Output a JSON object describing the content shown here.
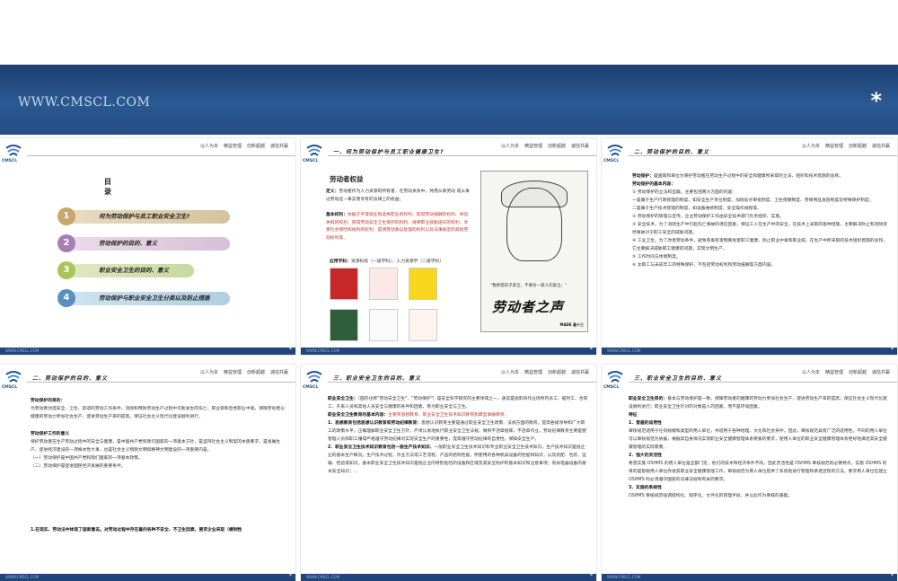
{
  "banner": {
    "url": "WWW.CMSCL.COM",
    "star": "*"
  },
  "header": {
    "logo_text": "CMSCL",
    "nav": [
      "以人为本",
      "精益管理",
      "创新超越",
      "诚信共赢"
    ],
    "footer_url": "WWW.CMSCL.COM",
    "footer_star": "*"
  },
  "slide1": {
    "toc_title": "目 录",
    "items": [
      {
        "num": "1",
        "label": "何为劳动保护与员工职业安全卫生?"
      },
      {
        "num": "2",
        "label": "劳动保护的目的、意义"
      },
      {
        "num": "3",
        "label": "职业安全卫生的目的、意义"
      },
      {
        "num": "4",
        "label": "劳动保护与职业安全卫生分类以及防止措施"
      }
    ]
  },
  "slide2": {
    "title": "一、何为劳动保护与员工职业健康卫生?",
    "heading": "劳动者权益",
    "def_label": "定义：",
    "def_text": "劳动者作为人力资源的所有者，在劳动关系中，凭借从事劳动 或从事过劳动这一事实而享有的法律上的权益。",
    "content_label": "基本权利：",
    "content_text": "依据于平等就业和选择职业的权利、取得劳动报酬的权利、休息休假的权利、获得劳动安全卫生保护的权利、接受职业技能培训的权利、享受社会保险和福利的权利、提请劳动争议处理的权利以及法律规定的其他劳动权利等。",
    "apply_label": "应用学科：",
    "apply_text": "资源科技（一级学科）；人力资源学（二级学科）",
    "poster_quote": "\"我希望孩子安全、不要有一家人的安全。\"",
    "poster_big": "劳动者之声",
    "poster_mark": "MADE 画十三"
  },
  "slide3": {
    "title": "二、劳动保护的目的、意义",
    "lines": [
      {
        "lbl": "劳动保护：",
        "text": "是国家和单位为保护劳动者在劳动生产过程中的安全和健康所采取的立法、组织和技术措施的总称。"
      },
      {
        "lbl": "劳动保护的基本内容：",
        "text": ""
      },
      {
        "lbl": "",
        "text": "① 劳动保护的立法和监察。主要包括两大方面的内容："
      },
      {
        "lbl": "",
        "text": "一是属于生产行政管理的制度，如安全生产责任制度、加班加点审批制度、卫生保健制度、劳保用品发放制度及特殊保护制度；"
      },
      {
        "lbl": "",
        "text": "二是属于生产技术管理的制度，如设备维修制度、安全操作规程等。"
      },
      {
        "lbl": "",
        "text": "② 劳动保护的管理与宣传。企业劳动保护工作由安全技术部门负责组织、实施。"
      },
      {
        "lbl": "",
        "text": "③ 安全技术。为了消除生产中引起伤亡事故的潜在因素，保证工人在生产中的安全，在技术上采取的各种措施，主要解决防止和消除突然事故对于职工安全的威胁问题。"
      },
      {
        "lbl": "",
        "text": "④ 工业卫生。为了改善劳动条件，避免有毒有害物质危害职工健康，防止职业中毒和职业病，在生产中所采取的技术组织措施的总和，它主要解决威胁职工健康的问题，实现文明生产。"
      },
      {
        "lbl": "",
        "text": "⑤ 工作时间与休假制度。"
      },
      {
        "lbl": "",
        "text": "⑥ 女职工与未成年工的特殊保护，不包括劳动权利和劳动报酬等方面内容。"
      }
    ]
  },
  "slide4": {
    "title": "二、劳动保护的目的、意义",
    "purpose_label": "劳动保护的目的：",
    "purpose_text": "为劳动者创造安全、卫生、舒适的劳动工作条件，消除和预防劳动生产过程中可能发生的伤亡、职业病和急性职业中毒，保障劳动者以健康的劳动力参加社会生产，促进劳动生产率的提高，保证社会主义现代化建设顺利进行。",
    "meaning_label": "劳动保护工作的意义",
    "meaning_text": "保护劳动者在生产劳动过程中的安全与健康，是中国共产党和我们国家的一项基本方针，是坚持社会主义制度的本质要求，是发展生产、促进经济建设的一项根本性大事，也是社会主义物质文明和精神文明建设的一项重要内容。",
    "sub1": "（一）劳动保护是中国共产党和我们国家的一项基本政策。",
    "sub2": "（二）劳动保护是促进国民经济发展的重要条件。",
    "bottom": "1.在现实、劳动法中体现了国家意志。对劳动过程中存在着的各种不安全、不卫生因素，要求企业采取（缠制性"
  },
  "slide5": {
    "title": "三、职业安全卫生的目的、意义",
    "p1_label": "职业安全卫生：",
    "p1_text": "（国内也称\"劳动安全卫生\"、\"劳动保护\"）是安全科学研究的主要领域之一，通常是指影响作业场所内员工、临时工、合同工、外来人员和其他人员安全与健康的条件和因素，称为职业安全与卫生。",
    "p2_label": "职业安全卫生教育的基本内容：",
    "p2_text": "主要有思想教育、职业安全卫生技术知识教育和典型事故教育。",
    "p3_label": "1．思想教育包括思想认识教育和劳动纪律教育：",
    "p3_text": "思想认识教育主要是通过职业安全卫生政策、法规方面的教育，提高各级领导和广大职工的政策水平，正确理解职业安全卫生方针，严肃认真地执行职业安全卫生法规，做到不违章指挥，不违章作业。劳动纪律教育主要是使管理人员和职工懂得严格遵守劳动纪律对实现安全生产的重要性，提高遵守劳动纪律的自觉性，保障安全生产。",
    "p4_label": "2．职业安全卫生技术知识教育包括一般生产技术知识、",
    "p4_text": "一般职业安全卫生技术知识和专业职业安全卫生技术知识。生产技术知识是指企业的基本生产概况，生产技术过程，作业方法或工艺流程，产品的结构性能，所使用的各种机具设备的性能和知识，以及装配、包装、运输、检验等知识。基本职业安全卫生技术知识是指企业内特别危险的设备和区域及其安全防护的基本知识和注意事项；有关电器设备的基本安全知识；..."
  },
  "slide6": {
    "title": "三、职业安全卫生的目的、意义",
    "p1_label": "职业安全卫生目的：",
    "p1_text": "基本与劳动保护是一致，保障劳动者的健康的劳动力参加社会生产，促进劳动生产率的提高，保证社会主义现代化建设顺利进行；职业安全卫生针对的对象是人的因素，而不是环境因素。",
    "feature": "特征",
    "f1_label": "1．普遍的适用性",
    "f1_text": "审核规范适用于任何规模和类型的用人单位，并适用于各种地理、文化和社会条件。因此，审核规范具有广泛的适用性。不同的用人单位可以审核规范为依据，根据其自身情况实现职业安全健康管理体系要素的要求，使用人单位的职业安全健康管理体系更好地满足其安全健康管理的实际需要。",
    "f2_label": "2．强大的灵活性",
    "f2_text": "希望实施 OSHMS 的用人单位是全部门定，他们的技术和经济条件不同，因此灵活性是 OSHMS 审核规范的必要特点。实施 OSHMS 的目的是帮助用人单位改进其职业安全健康管理工作，审核规范为用人单位提供了系统地进行管理和承诺且现的方法。要求用人单位在建立 OSHMS 时必须遵守国家的法律法规和有关的要求。",
    "f3_label": "3．实施的系统性",
    "f3_text": "OSHMS 审核规范强调结构化、程序化、文件化的管理手段，并以此作为审核的基础。"
  }
}
